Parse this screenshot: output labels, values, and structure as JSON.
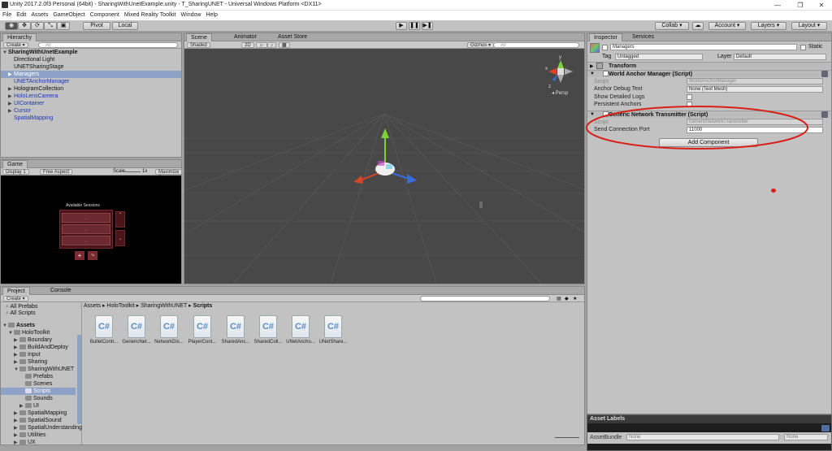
{
  "window": {
    "title": "Unity 2017.2.0f3 Personal (64bit) - SharingWithUnetExample.unity - T_SharingUNET - Universal Windows Platform <DX11>",
    "minimize": "—",
    "maximize": "❐",
    "close": "✕"
  },
  "menu": [
    "File",
    "Edit",
    "Assets",
    "GameObject",
    "Component",
    "Mixed Reality Toolkit",
    "Window",
    "Help"
  ],
  "toolbar": {
    "pivot": "Pivot",
    "local": "Local",
    "collab": "Collab ▾",
    "account": "Account ▾",
    "layers": "Layers ▾",
    "layout": "Layout ▾"
  },
  "hierarchy": {
    "tab": "Hierarchy",
    "create": "Create ▾",
    "search": "All",
    "scene": "SharingWithUnetExample",
    "items": [
      {
        "label": "Directional Light",
        "style": "normal"
      },
      {
        "label": "UNETSharingStage",
        "style": "normal"
      },
      {
        "label": "Managers",
        "style": "selected"
      },
      {
        "label": "UNETAnchorManager",
        "style": "blue"
      },
      {
        "label": "HologramCollection",
        "style": "normal"
      },
      {
        "label": "HoloLensCamera",
        "style": "blue"
      },
      {
        "label": "UIContainer",
        "style": "blue"
      },
      {
        "label": "Cursor",
        "style": "blue"
      },
      {
        "label": "SpatialMapping",
        "style": "blue"
      }
    ]
  },
  "scene": {
    "tabs": [
      "Scene",
      "Animator",
      "Asset Store"
    ],
    "shading": "Shaded",
    "mode2d": "2D",
    "gizmos": "Gizmos ▾",
    "search": "All",
    "persp": "◂ Persp",
    "axis": {
      "x": "x",
      "y": "y",
      "z": "z"
    }
  },
  "game": {
    "tab": "Game",
    "display": "Display 1",
    "aspect": "Free Aspect",
    "scale_label": "Scale",
    "scale_value": "1x",
    "maximize": "Maximize On",
    "panel_title": "Available Sessions",
    "session_rows": [
      "...",
      "...",
      "..."
    ]
  },
  "inspector": {
    "tabs": [
      "Inspector",
      "Services"
    ],
    "object_name": "Managers",
    "static": "Static",
    "tag_label": "Tag",
    "tag_value": "Untagged",
    "layer_label": "Layer",
    "layer_value": "Default",
    "transform": "Transform",
    "world_anchor": {
      "title": "World Anchor Manager (Script)",
      "script_label": "Script",
      "script_value": "WorldAnchorManager",
      "debug_label": "Anchor Debug Text",
      "debug_value": "None (Text Mesh)",
      "detailed_label": "Show Detailed Logs",
      "persist_label": "Persistent Anchors"
    },
    "network": {
      "title": "Generic Network Transmitter (Script)",
      "script_label": "Script",
      "script_value": "GenericNetworkTransmitter",
      "port_label": "Send Connection Port",
      "port_value": "11000"
    },
    "add_component": "Add Component"
  },
  "asset_labels": {
    "title": "Asset Labels",
    "bundle_label": "AssetBundle",
    "bundle_value": "None",
    "variant_value": "None"
  },
  "project": {
    "tabs": [
      "Project",
      "Console"
    ],
    "create": "Create ▾",
    "favorites": [
      "All Prefabs",
      "All Scripts"
    ],
    "breadcrumb": [
      "Assets",
      "HoloToolkit",
      "SharingWithUNET",
      "Scripts"
    ],
    "tree": [
      {
        "label": "Assets",
        "depth": 0,
        "bold": true
      },
      {
        "label": "HoloToolkit",
        "depth": 1
      },
      {
        "label": "Boundary",
        "depth": 2
      },
      {
        "label": "BuildAndDeploy",
        "depth": 2
      },
      {
        "label": "Input",
        "depth": 2
      },
      {
        "label": "Sharing",
        "depth": 2
      },
      {
        "label": "SharingWithUNET",
        "depth": 2
      },
      {
        "label": "Prefabs",
        "depth": 3
      },
      {
        "label": "Scenes",
        "depth": 3
      },
      {
        "label": "Scripts",
        "depth": 3,
        "selected": true
      },
      {
        "label": "Sounds",
        "depth": 3
      },
      {
        "label": "UI",
        "depth": 3
      },
      {
        "label": "SpatialMapping",
        "depth": 2
      },
      {
        "label": "SpatialSound",
        "depth": 2
      },
      {
        "label": "SpatialUnderstanding",
        "depth": 2
      },
      {
        "label": "Utilities",
        "depth": 2
      },
      {
        "label": "UX",
        "depth": 2
      }
    ],
    "files": [
      "BulletContr...",
      "GenericNet...",
      "NetworkDis...",
      "PlayerCont...",
      "SharedAnc...",
      "SharedColl...",
      "UNetAncho...",
      "UNetShare..."
    ],
    "cs_glyph": "C#"
  }
}
